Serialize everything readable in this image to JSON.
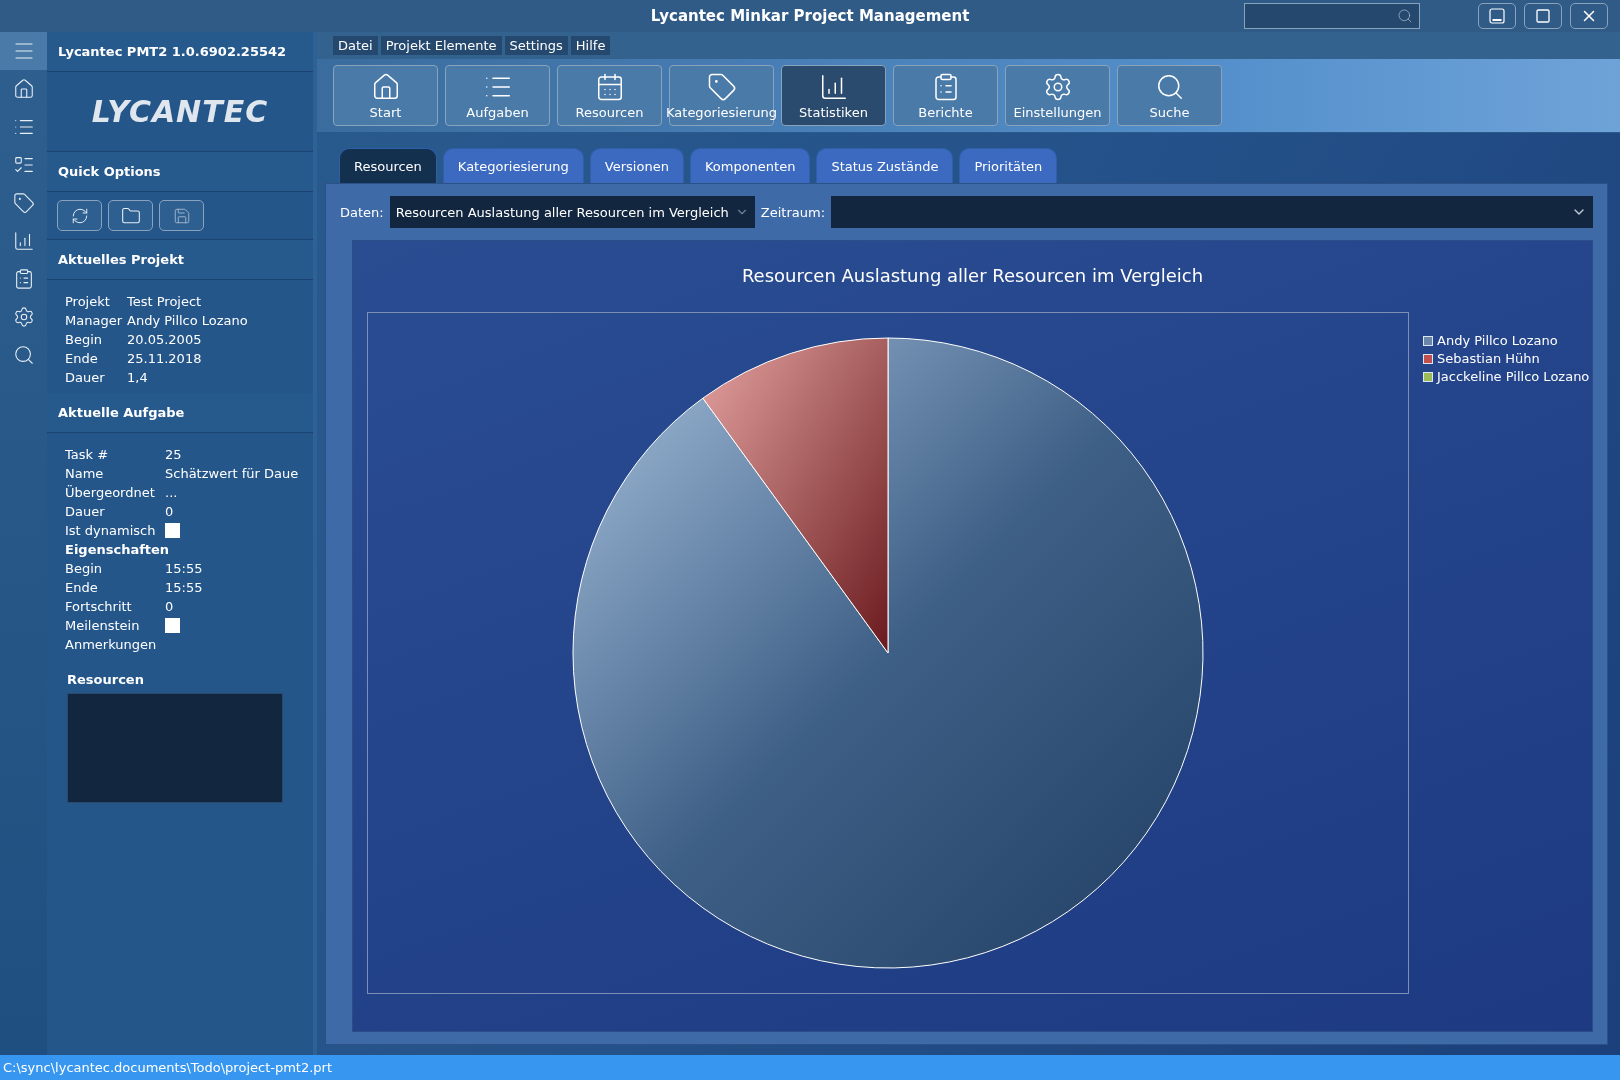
{
  "window": {
    "title": "Lycantec Minkar Project Management"
  },
  "menu": [
    "Datei",
    "Projekt Elemente",
    "Settings",
    "Hilfe"
  ],
  "toolbar": [
    {
      "label": "Start",
      "selected": false
    },
    {
      "label": "Aufgaben",
      "selected": false
    },
    {
      "label": "Resourcen",
      "selected": false
    },
    {
      "label": "Kategoriesierung",
      "selected": false
    },
    {
      "label": "Statistiken",
      "selected": true
    },
    {
      "label": "Berichte",
      "selected": false
    },
    {
      "label": "Einstellungen",
      "selected": false
    },
    {
      "label": "Suche",
      "selected": false
    }
  ],
  "sidebar": {
    "app_version": "Lycantec PMT2 1.0.6902.25542",
    "logo": "LYCANTEC",
    "quick_options": {
      "title": "Quick Options"
    },
    "current_project": {
      "title": "Aktuelles Projekt",
      "fields": [
        {
          "label": "Projekt",
          "value": "Test Project"
        },
        {
          "label": "Manager",
          "value": "Andy Pillco Lozano"
        },
        {
          "label": "Begin",
          "value": "20.05.2005"
        },
        {
          "label": "Ende",
          "value": "25.11.2018"
        },
        {
          "label": "Dauer",
          "value": "1,4"
        }
      ]
    },
    "current_task": {
      "title": "Aktuelle Aufgabe",
      "fields": [
        {
          "kind": "text",
          "label": "Task #",
          "value": "25"
        },
        {
          "kind": "text",
          "label": "Name",
          "value": "Schätzwert für Daue"
        },
        {
          "kind": "text",
          "label": "Übergeordnet",
          "value": "..."
        },
        {
          "kind": "text",
          "label": "Dauer",
          "value": "0"
        },
        {
          "kind": "checkbox",
          "label": "Ist dynamisch",
          "checked": false
        },
        {
          "kind": "heading",
          "label": "Eigenschaften"
        },
        {
          "kind": "text",
          "label": "Begin",
          "value": "15:55"
        },
        {
          "kind": "text",
          "label": "Ende",
          "value": "15:55"
        },
        {
          "kind": "text",
          "label": "Fortschritt",
          "value": "0"
        },
        {
          "kind": "checkbox",
          "label": "Meilenstein",
          "checked": false
        },
        {
          "kind": "label",
          "label": "Anmerkungen"
        }
      ],
      "resources_title": "Resourcen"
    }
  },
  "tabs": [
    {
      "label": "Resourcen",
      "selected": true
    },
    {
      "label": "Kategoriesierung",
      "selected": false
    },
    {
      "label": "Versionen",
      "selected": false
    },
    {
      "label": "Komponenten",
      "selected": false
    },
    {
      "label": "Status Zustände",
      "selected": false
    },
    {
      "label": "Prioritäten",
      "selected": false
    }
  ],
  "filters": {
    "data_label": "Daten:",
    "data_value": "Resourcen Auslastung aller Resourcen im Vergleich",
    "period_label": "Zeitraum:"
  },
  "chart": {
    "title": "Resourcen Auslastung aller Resourcen im Vergleich",
    "legend": [
      {
        "name": "Andy Pillco Lozano",
        "color": "#6a86a8"
      },
      {
        "name": "Sebastian Hühn",
        "color": "#c0504d"
      },
      {
        "name": "Jacckeline Pillco Lozano",
        "color": "#9bbb59"
      }
    ]
  },
  "status_bar": "C:\\sync\\lycantec.documents\\Todo\\project-pmt2.prt"
}
